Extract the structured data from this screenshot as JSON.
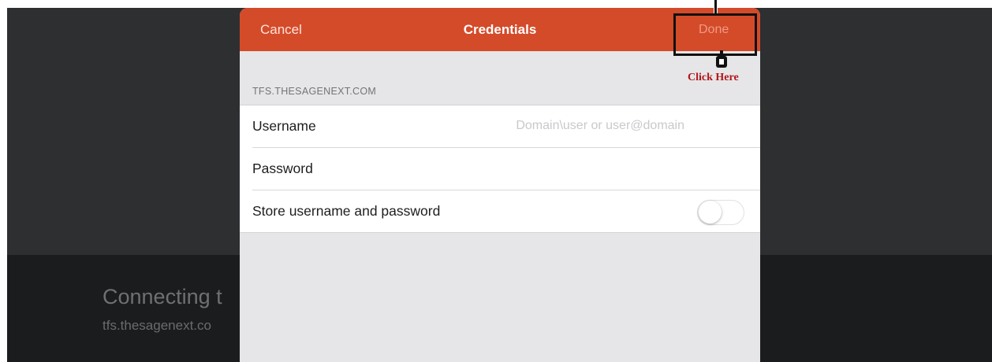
{
  "background": {
    "title": "Connecting t",
    "subtitle": "tfs.thesagenext.co"
  },
  "modal": {
    "nav": {
      "cancel_label": "Cancel",
      "title": "Credentials",
      "done_label": "Done"
    },
    "section_header": "TFS.THESAGENEXT.COM",
    "rows": {
      "username_label": "Username",
      "username_placeholder": "Domain\\user or user@domain",
      "password_label": "Password",
      "store_label": "Store username and password",
      "store_enabled": false
    }
  },
  "annotation": {
    "label": "Click Here"
  },
  "colors": {
    "accent": "#d44b2a",
    "annotation_text": "#b3151b"
  }
}
